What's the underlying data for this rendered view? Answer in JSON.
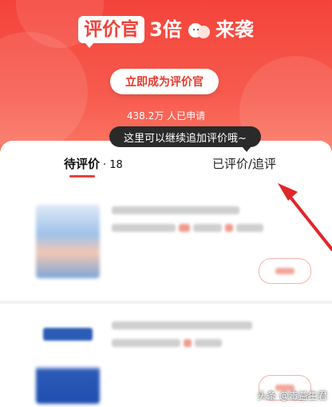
{
  "banner": {
    "badge": "评价官",
    "multiplier": "3倍",
    "suffix": "来袭",
    "cta_label": "立即成为评价官",
    "applied_count": "438.2万 人已申请"
  },
  "tooltip": "这里可以继续追加评价哦~",
  "tabs": {
    "pending_label": "待评价",
    "pending_count": "· 18",
    "reviewed_label": "已评价/追评"
  },
  "watermark": "头条 @毒益生君",
  "colors": {
    "accent": "#f4433a",
    "tooltip_bg": "#2a2a2a",
    "annotation_arrow": "#e0262a"
  }
}
